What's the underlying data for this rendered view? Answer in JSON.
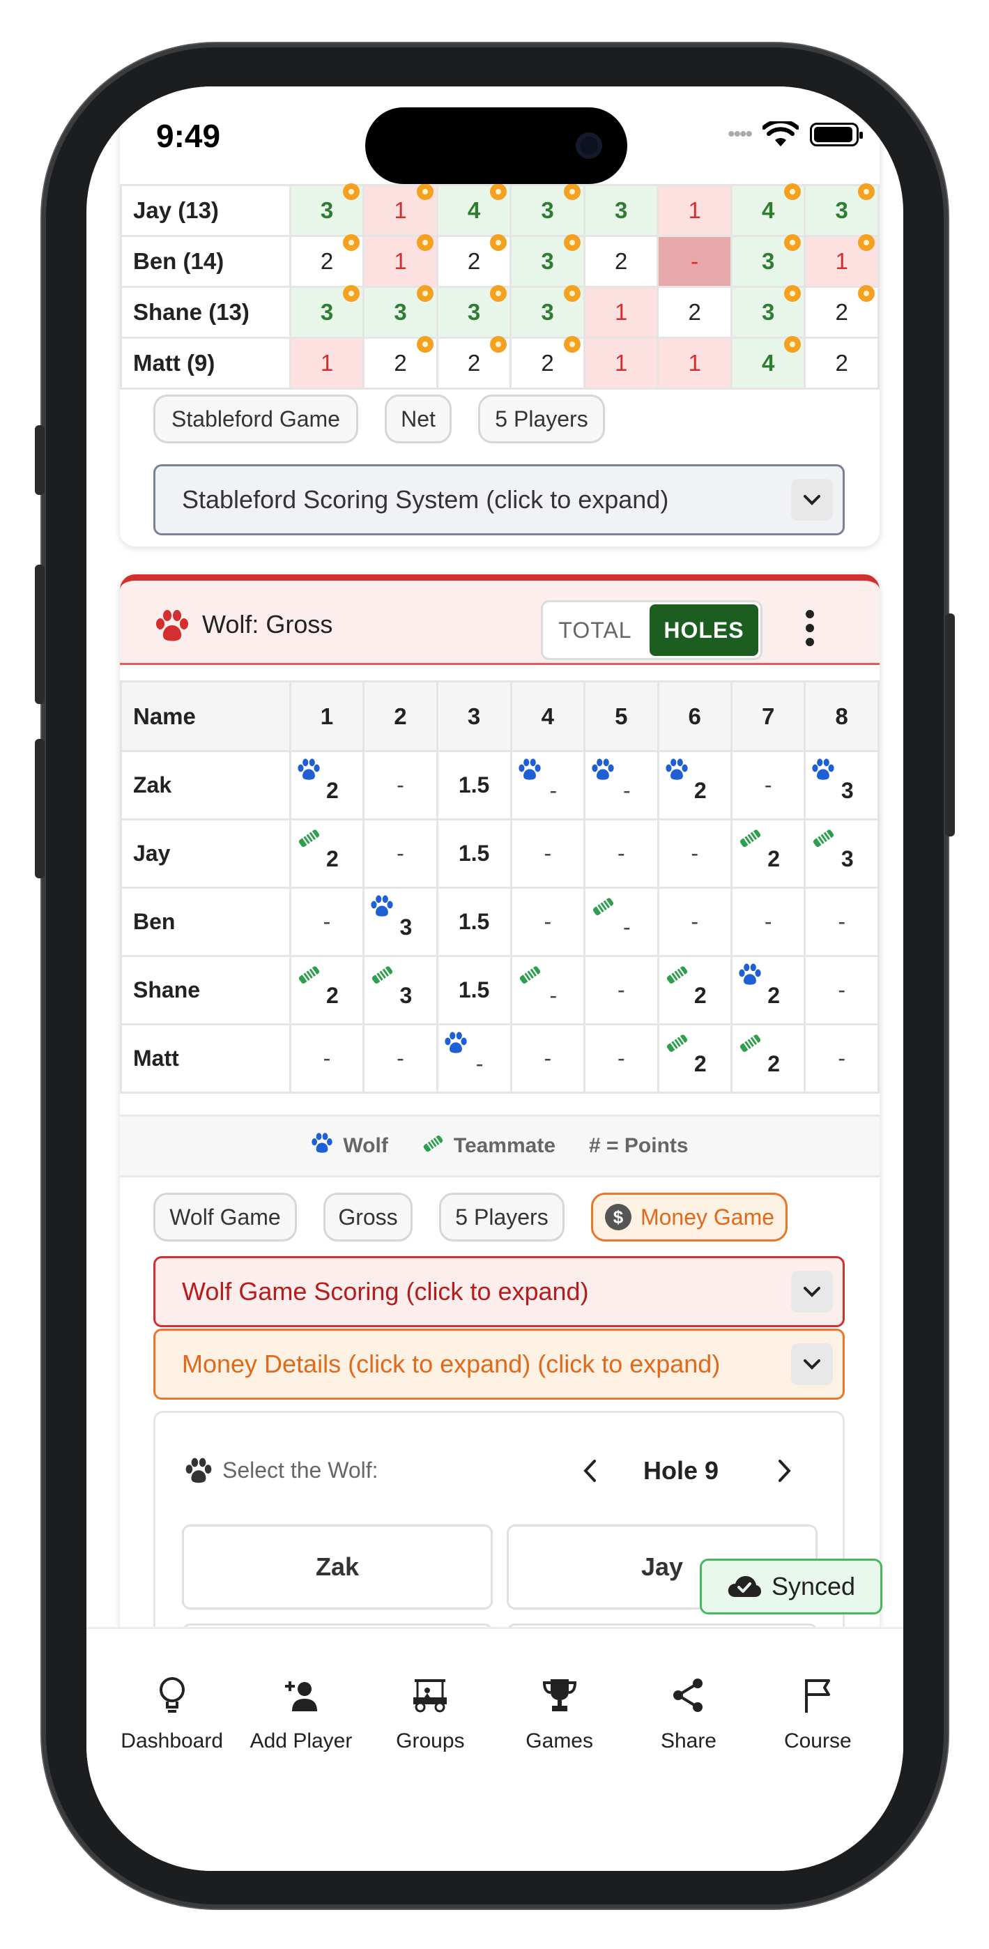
{
  "status": {
    "time": "9:49"
  },
  "stableford": {
    "rows": [
      {
        "name": "Jay (13)",
        "cells": [
          {
            "v": "3",
            "c": "g",
            "dot": true
          },
          {
            "v": "1",
            "c": "r",
            "dot": true
          },
          {
            "v": "4",
            "c": "g",
            "dot": true
          },
          {
            "v": "3",
            "c": "g",
            "dot": true
          },
          {
            "v": "3",
            "c": "g",
            "dot": false
          },
          {
            "v": "1",
            "c": "r",
            "dot": false
          },
          {
            "v": "4",
            "c": "g",
            "dot": true
          },
          {
            "v": "3",
            "c": "g",
            "dot": true
          }
        ]
      },
      {
        "name": "Ben (14)",
        "cells": [
          {
            "v": "2",
            "c": "w",
            "dot": true
          },
          {
            "v": "1",
            "c": "r",
            "dot": true
          },
          {
            "v": "2",
            "c": "w",
            "dot": true
          },
          {
            "v": "3",
            "c": "g",
            "dot": true
          },
          {
            "v": "2",
            "c": "w",
            "dot": false
          },
          {
            "v": "-",
            "c": "rd",
            "dot": false
          },
          {
            "v": "3",
            "c": "g",
            "dot": true
          },
          {
            "v": "1",
            "c": "r",
            "dot": true
          }
        ]
      },
      {
        "name": "Shane (13)",
        "cells": [
          {
            "v": "3",
            "c": "g",
            "dot": true
          },
          {
            "v": "3",
            "c": "g",
            "dot": true
          },
          {
            "v": "3",
            "c": "g",
            "dot": true
          },
          {
            "v": "3",
            "c": "g",
            "dot": true
          },
          {
            "v": "1",
            "c": "r",
            "dot": false
          },
          {
            "v": "2",
            "c": "w",
            "dot": false
          },
          {
            "v": "3",
            "c": "g",
            "dot": true
          },
          {
            "v": "2",
            "c": "w",
            "dot": true
          }
        ]
      },
      {
        "name": "Matt (9)",
        "cells": [
          {
            "v": "1",
            "c": "r",
            "dot": false
          },
          {
            "v": "2",
            "c": "w",
            "dot": true
          },
          {
            "v": "2",
            "c": "w",
            "dot": true
          },
          {
            "v": "2",
            "c": "w",
            "dot": true
          },
          {
            "v": "1",
            "c": "r",
            "dot": false
          },
          {
            "v": "1",
            "c": "r",
            "dot": false
          },
          {
            "v": "4",
            "c": "g",
            "dot": true
          },
          {
            "v": "2",
            "c": "w",
            "dot": false
          }
        ]
      }
    ],
    "chips": [
      "Stableford Game",
      "Net",
      "5 Players"
    ],
    "expander": "Stableford Scoring System (click to expand)"
  },
  "wolf": {
    "title": "Wolf: Gross",
    "toggle_total": "TOTAL",
    "toggle_holes": "HOLES",
    "header_name": "Name",
    "holes": [
      "1",
      "2",
      "3",
      "4",
      "5",
      "6",
      "7",
      "8"
    ],
    "rows": [
      {
        "name": "Zak",
        "cells": [
          {
            "v": "2",
            "i": "wolf",
            "b": true
          },
          {
            "v": "-",
            "i": "",
            "b": false
          },
          {
            "v": "1.5",
            "i": "",
            "b": true
          },
          {
            "v": "-",
            "i": "wolf",
            "b": false
          },
          {
            "v": "-",
            "i": "wolf",
            "b": false
          },
          {
            "v": "2",
            "i": "wolf",
            "b": true
          },
          {
            "v": "-",
            "i": "",
            "b": false
          },
          {
            "v": "3",
            "i": "wolf",
            "b": true
          }
        ]
      },
      {
        "name": "Jay",
        "cells": [
          {
            "v": "2",
            "i": "team",
            "b": true
          },
          {
            "v": "-",
            "i": "",
            "b": false
          },
          {
            "v": "1.5",
            "i": "",
            "b": true
          },
          {
            "v": "-",
            "i": "",
            "b": false
          },
          {
            "v": "-",
            "i": "",
            "b": false
          },
          {
            "v": "-",
            "i": "",
            "b": false
          },
          {
            "v": "2",
            "i": "team",
            "b": true
          },
          {
            "v": "3",
            "i": "team",
            "b": true
          }
        ]
      },
      {
        "name": "Ben",
        "cells": [
          {
            "v": "-",
            "i": "",
            "b": false
          },
          {
            "v": "3",
            "i": "wolf",
            "b": true
          },
          {
            "v": "1.5",
            "i": "",
            "b": true
          },
          {
            "v": "-",
            "i": "",
            "b": false
          },
          {
            "v": "-",
            "i": "team",
            "b": false
          },
          {
            "v": "-",
            "i": "",
            "b": false
          },
          {
            "v": "-",
            "i": "",
            "b": false
          },
          {
            "v": "-",
            "i": "",
            "b": false
          }
        ]
      },
      {
        "name": "Shane",
        "cells": [
          {
            "v": "2",
            "i": "team",
            "b": true
          },
          {
            "v": "3",
            "i": "team",
            "b": true
          },
          {
            "v": "1.5",
            "i": "",
            "b": true
          },
          {
            "v": "-",
            "i": "team",
            "b": false
          },
          {
            "v": "-",
            "i": "",
            "b": false
          },
          {
            "v": "2",
            "i": "team",
            "b": true
          },
          {
            "v": "2",
            "i": "wolf",
            "b": true
          },
          {
            "v": "-",
            "i": "",
            "b": false
          }
        ]
      },
      {
        "name": "Matt",
        "cells": [
          {
            "v": "-",
            "i": "",
            "b": false
          },
          {
            "v": "-",
            "i": "",
            "b": false
          },
          {
            "v": "-",
            "i": "wolf",
            "b": false
          },
          {
            "v": "-",
            "i": "",
            "b": false
          },
          {
            "v": "-",
            "i": "",
            "b": false
          },
          {
            "v": "2",
            "i": "team",
            "b": true
          },
          {
            "v": "2",
            "i": "team",
            "b": true
          },
          {
            "v": "-",
            "i": "",
            "b": false
          }
        ]
      }
    ],
    "legend_wolf": "Wolf",
    "legend_teammate": "Teammate",
    "legend_points": "# = Points",
    "chips": [
      "Wolf Game",
      "Gross",
      "5 Players"
    ],
    "money_chip": "Money Game",
    "scoring_expander": "Wolf Game Scoring (click to expand)",
    "money_expander": "Money Details (click to expand) (click to expand)",
    "select_label": "Select the Wolf:",
    "hole_label": "Hole 9",
    "players": [
      "Zak",
      "Jay"
    ]
  },
  "synced": "Synced",
  "nav": [
    {
      "label": "Dashboard",
      "icon": "lightbulb-icon"
    },
    {
      "label": "Add Player",
      "icon": "add-user-icon"
    },
    {
      "label": "Groups",
      "icon": "golf-cart-icon"
    },
    {
      "label": "Games",
      "icon": "trophy-icon"
    },
    {
      "label": "Share",
      "icon": "share-icon"
    },
    {
      "label": "Course",
      "icon": "flag-icon"
    }
  ],
  "colors": {
    "wolf_red": "#d32f2f",
    "holes_green": "#1b5e20",
    "wolf_blue": "#1f5fd6",
    "teammate_green": "#2e9e4f",
    "money_orange": "#e8762b"
  }
}
